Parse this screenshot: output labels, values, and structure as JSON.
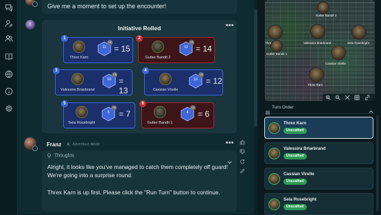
{
  "top_message": {
    "text": "Give me a moment to set up the encounter!"
  },
  "initiative": {
    "title": "Initiative Rolled",
    "rolls": [
      {
        "index": "1",
        "name": "Threx Karn",
        "roll": "11",
        "mod": "+4",
        "total": "15",
        "side": "ally"
      },
      {
        "index": "2",
        "name": "Gutter Bandit 2",
        "roll": "12",
        "mod": "+2",
        "total": "14",
        "side": "enemy"
      },
      {
        "index": "3",
        "name": "Valessira Briarbrand",
        "roll": "10",
        "mod": "+3",
        "total": "13",
        "side": "ally"
      },
      {
        "index": "4",
        "name": "Cassian Virelle",
        "roll": "10",
        "mod": "+2",
        "total": "12",
        "side": "ally"
      },
      {
        "index": "5",
        "name": "Sela Rosebright",
        "roll": "5",
        "mod": "+2",
        "total": "7",
        "side": "ally"
      },
      {
        "index": "6",
        "name": "Gutter Bandit 1",
        "roll": "4",
        "mod": "+2",
        "total": "6",
        "side": "enemy"
      }
    ]
  },
  "franz_message": {
    "author": "Franz",
    "mode": "Adventure Mode",
    "thoughts_label": "Thoughts",
    "paragraph1": "Alright, it looks like you've managed to catch them completely off guard! We're going into a surprise round.",
    "paragraph2": "Threx Karn is up first. Please click the \"Run Turn\" button to continue."
  },
  "map": {
    "tokens": [
      "Threx Karn",
      "Gutter Bandit 1",
      "Valessira Briarbrand",
      "Sela Rosebright",
      "Cassian Virelle",
      "Threx Karn",
      "Gutter Bandit 2"
    ]
  },
  "turn_order": {
    "title": "Turn Order",
    "entries": [
      {
        "name": "Threx Karn",
        "status": "Unscathed",
        "active": true
      },
      {
        "name": "Valessira Briarbrand",
        "status": "Unscathed",
        "active": false
      },
      {
        "name": "Cassian Virelle",
        "status": "Unscathed",
        "active": false
      },
      {
        "name": "Sela Rosebright",
        "status": "Unscathed",
        "active": false
      }
    ]
  },
  "colors": {
    "ally": "#3e66d6",
    "enemy": "#a3272e",
    "status_green": "#2d9b57",
    "active_border": "#d8e2ec"
  },
  "icons": [
    "chat-icon",
    "user-edit-icon",
    "users-icon",
    "book-icon",
    "globe-icon",
    "info-icon",
    "gear-icon"
  ]
}
